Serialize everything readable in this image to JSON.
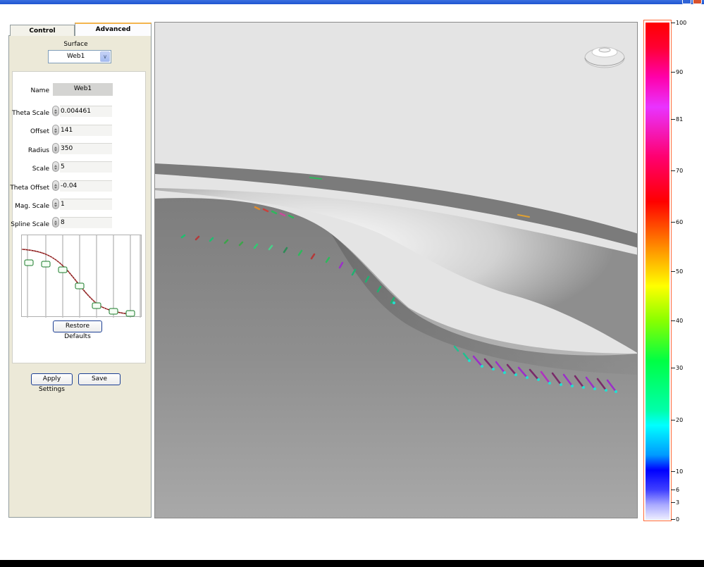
{
  "tabs": [
    {
      "label": "Control"
    },
    {
      "label": "Advanced"
    }
  ],
  "surface": {
    "label": "Surface",
    "selected": "Web1"
  },
  "settings": {
    "name_label": "Name",
    "name_value": "Web1",
    "fields": [
      {
        "label": "Theta Scale",
        "value": "0.004461"
      },
      {
        "label": "Offset",
        "value": "141"
      },
      {
        "label": "Radius",
        "value": "350"
      },
      {
        "label": "Scale",
        "value": "5"
      },
      {
        "label": "Theta Offset",
        "value": "-0.04"
      },
      {
        "label": "Mag. Scale",
        "value": "1"
      },
      {
        "label": "Spline Scale",
        "value": "8"
      }
    ]
  },
  "buttons": {
    "restore": "Restore Defaults",
    "apply": "Apply Settings",
    "save": "Save"
  },
  "colorbar": {
    "ticks": [
      {
        "label": "100",
        "value": 100
      },
      {
        "label": "90",
        "value": 90
      },
      {
        "label": "81",
        "value": 81
      },
      {
        "label": "70",
        "value": 70
      },
      {
        "label": "60",
        "value": 60
      },
      {
        "label": "50",
        "value": 50
      },
      {
        "label": "40",
        "value": 40
      },
      {
        "label": "30",
        "value": 30
      },
      {
        "label": "20",
        "value": 20
      },
      {
        "label": "10",
        "value": 10
      },
      {
        "label": "6",
        "value": 6
      },
      {
        "label": "3",
        "value": 3
      },
      {
        "label": "0",
        "value": 0
      }
    ]
  },
  "colors": {
    "accent_tab": "#f3b54e",
    "button_border": "#1c3f94"
  }
}
